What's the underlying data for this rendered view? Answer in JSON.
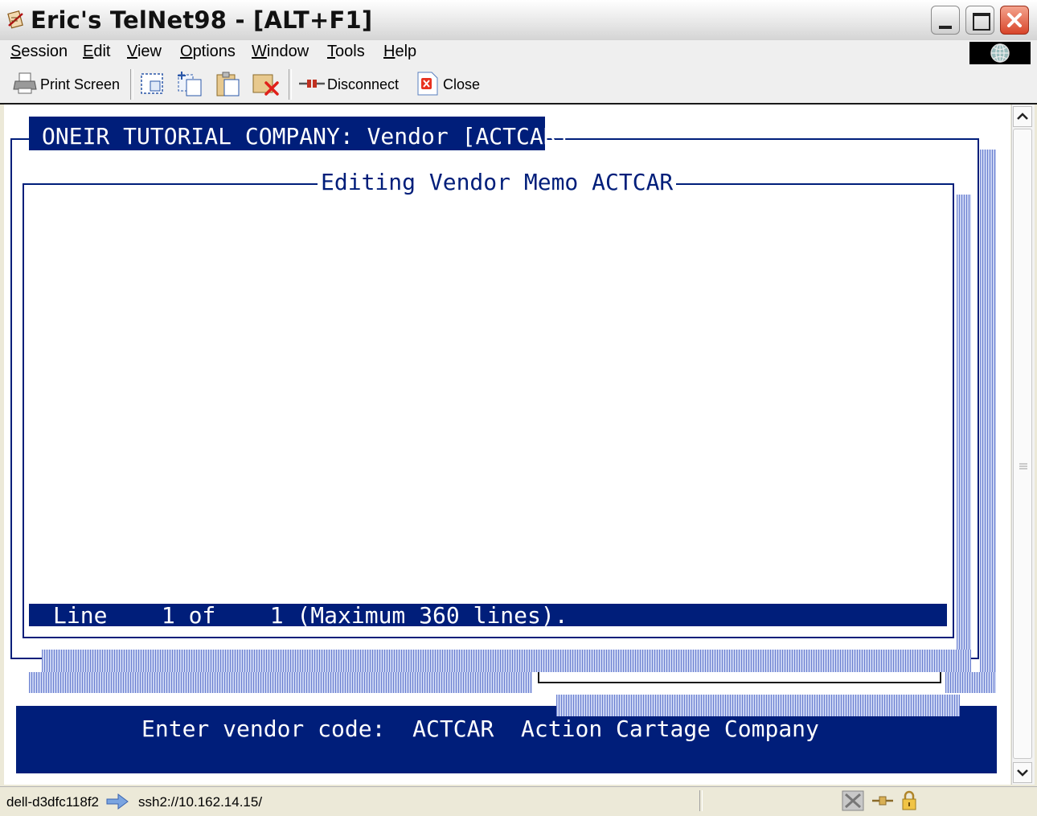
{
  "window": {
    "title": "Eric's TelNet98 - [ALT+F1]"
  },
  "menu": {
    "items": [
      "Session",
      "Edit",
      "View",
      "Options",
      "Window",
      "Tools",
      "Help"
    ],
    "accelerators": [
      "S",
      "E",
      "V",
      "O",
      "W",
      "T",
      "H"
    ]
  },
  "toolbar": {
    "print_screen_label": "Print Screen",
    "disconnect_label": "Disconnect",
    "close_label": "Close"
  },
  "terminal": {
    "company_header": "ONEIR TUTORIAL COMPANY: Vendor [ACTCAR]",
    "memo_title": "Editing Vendor Memo ACTCAR",
    "status_line": "Line    1 of    1 (Maximum 360 lines).",
    "prompt_label": "Enter vendor code:",
    "vendor_code": "ACTCAR",
    "vendor_name": "Action Cartage Company",
    "colors": {
      "terminal_blue": "#001e7a",
      "terminal_bg": "#ffffff"
    }
  },
  "statusbar": {
    "host": "dell-d3dfc118f2",
    "connection": "ssh2://10.162.14.15/"
  },
  "icons": {
    "app": "telnet-app-icon",
    "print": "printer-icon",
    "disconnect": "disconnect-plug-icon",
    "close": "close-session-icon",
    "globe": "globe-icon",
    "lock": "lock-icon"
  }
}
